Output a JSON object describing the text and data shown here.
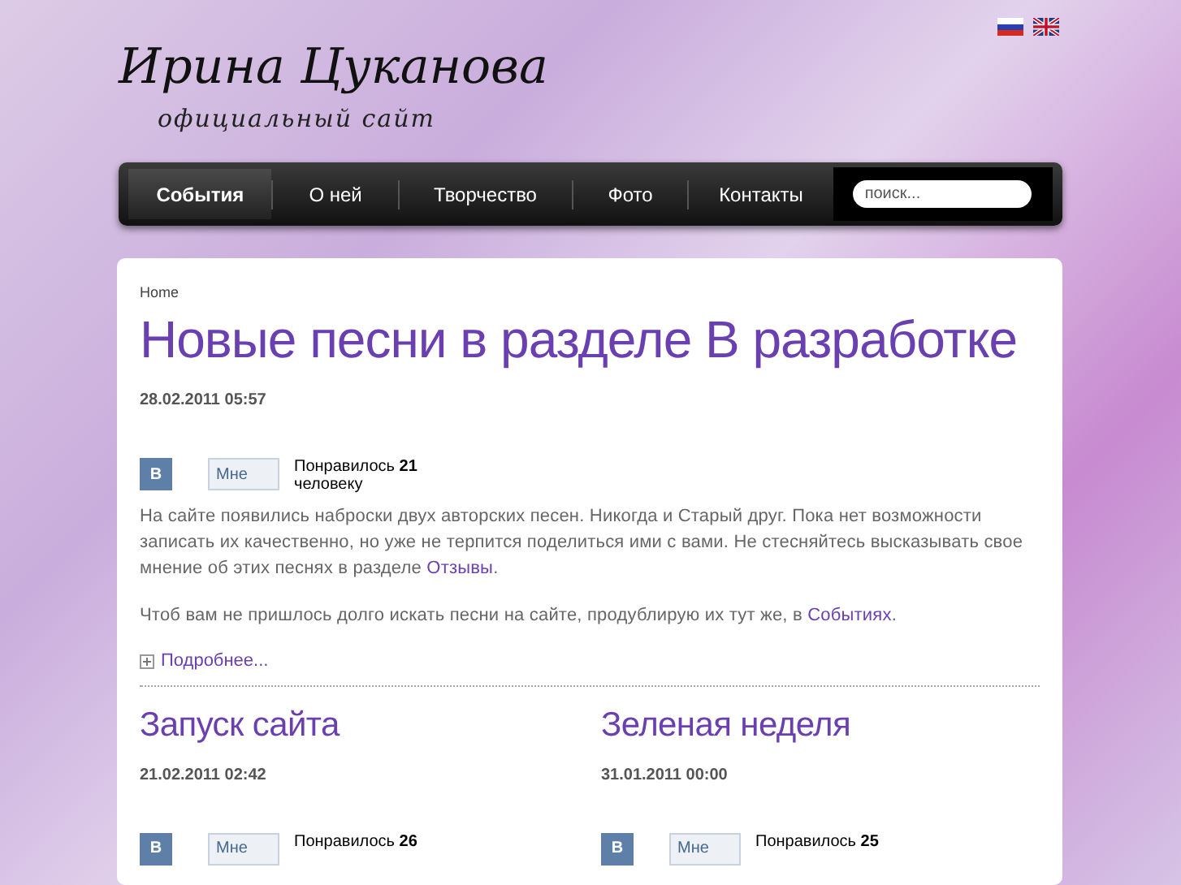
{
  "header": {
    "title": "Ирина Цуканова",
    "subtitle": "официальный сайт",
    "languages": [
      {
        "kind": "ru"
      },
      {
        "kind": "en"
      }
    ]
  },
  "nav": {
    "items": [
      {
        "label": "События",
        "selected": true
      },
      {
        "label": "О ней",
        "selected": false
      },
      {
        "label": "Творчество",
        "selected": false
      },
      {
        "label": "Фото",
        "selected": false
      },
      {
        "label": "Контакты",
        "selected": false
      }
    ],
    "search": {
      "placeholder": "поиск..."
    }
  },
  "breadcrumb": "Home",
  "lead": {
    "title": "Новые песни в разделе В разработке",
    "date": "28.02.2011 05:57",
    "like": {
      "badge": "В",
      "button": "Мне",
      "count": "Понравилось **21**",
      "count_line_2": "человеку"
    },
    "paragraphs": [
      [
        {
          "text": "На сайте появились наброски двух авторских песен. Никогда и Старый друг. Пока нет возможности записать их качественно, но уже не терпится поделиться ими с вами. Не стесняйтесь высказывать свое мнение об этих песнях в разделе "
        },
        {
          "text": "Отзывы",
          "link": true
        },
        {
          "text": "."
        }
      ],
      [
        {
          "text": "Чтоб вам не пришлось долго искать песни на сайте, продублирую их тут же, в "
        },
        {
          "text": "Событиях",
          "link": true
        },
        {
          "text": "."
        }
      ]
    ],
    "more": "Подробнее..."
  },
  "posts": [
    {
      "title": "Запуск сайта",
      "date": "21.02.2011 02:42",
      "like": {
        "badge": "В",
        "button": "Мне",
        "count": "Понравилось **26**"
      }
    },
    {
      "title": "Зеленая неделя",
      "date": "31.01.2011 00:00",
      "like": {
        "badge": "В",
        "button": "Мне",
        "count": "Понравилось **25**"
      }
    }
  ]
}
